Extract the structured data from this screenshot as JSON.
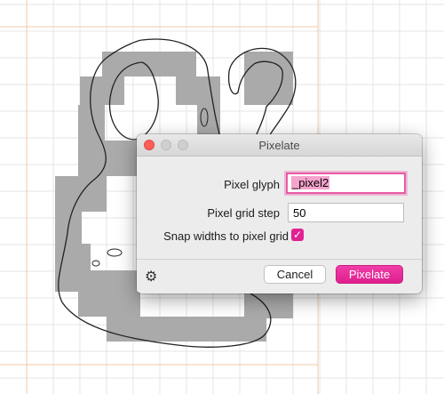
{
  "dialog": {
    "title": "Pixelate",
    "pixel_glyph_label": "Pixel glyph",
    "pixel_glyph_value": "_pixel2",
    "grid_step_label": "Pixel grid step",
    "grid_step_value": "50",
    "snap_label": "Snap widths to pixel grid",
    "snap_checked": true,
    "check_glyph": "✓",
    "cancel_label": "Cancel",
    "pixelate_label": "Pixelate",
    "gear_icon": "⚙"
  },
  "canvas": {
    "glyph": "ampersand outline over gray pixel grid"
  },
  "colors": {
    "accent": "#e02392",
    "grid_line": "#e4e4e4",
    "guide_line": "#f2c9a8",
    "pixel_fill": "#aaaaaa"
  }
}
